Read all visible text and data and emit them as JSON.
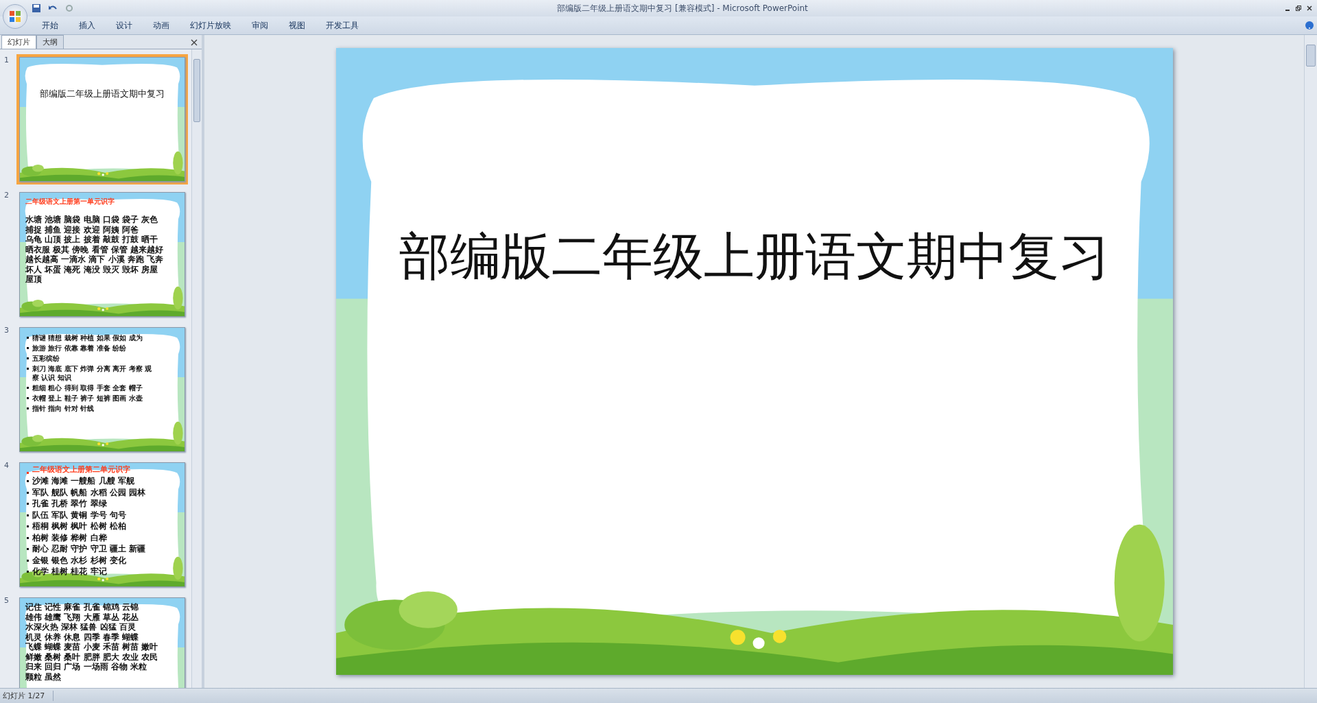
{
  "window": {
    "title": "部编版二年级上册语文期中复习 [兼容模式] - Microsoft PowerPoint"
  },
  "ribbon_tabs": [
    "开始",
    "插入",
    "设计",
    "动画",
    "幻灯片放映",
    "审阅",
    "视图",
    "开发工具"
  ],
  "panel_tabs": [
    {
      "label": "幻灯片",
      "selected": true
    },
    {
      "label": "大纲",
      "selected": false
    }
  ],
  "slides": [
    {
      "number": "1",
      "selected": true,
      "kind": "title",
      "title": "部编版二年级上册语文期中复习"
    },
    {
      "number": "2",
      "selected": false,
      "kind": "lines",
      "heading": "二年级语文上册第一单元识字",
      "lines": [
        "水塘 池塘 脑袋 电脑 口袋 袋子 灰色",
        "捕捉 捕鱼 迎接 欢迎 阿姨 阿爸",
        "乌龟 山顶 披上 披着 敲鼓 打鼓 晒干",
        "晒衣服 极其 傍晚 看管 保管 越来越好",
        "越长越高 一滴水 滴下 小溪 奔跑 飞奔",
        "坏人 坏蛋 淹死 淹没 毁灭 毁坏 房屋",
        "屋顶"
      ]
    },
    {
      "number": "3",
      "selected": false,
      "kind": "bullets",
      "lines": [
        "猜谜 猜想 栽树 种植 如果 假如 成为",
        "旅游 旅行 依靠 靠着 准备 纷纷",
        "五彩缤纷",
        "刺刀 海底 底下 炸弹 分离 离开 考察 观察 认识 知识",
        "粗细 粗心 得到 取得 手套 全套 帽子",
        "衣帽 登上 鞋子 裤子 短裤 图画 水壶",
        "指针 指向 针对 针线"
      ]
    },
    {
      "number": "4",
      "selected": false,
      "kind": "bullets",
      "heading": "二年级语文上册第二单元识字",
      "lines": [
        "沙滩 海滩 一艘船 几艘 军舰",
        "军队 舰队 帆船 水稻 公园 园林",
        "孔雀 孔桥 翠竹 翠绿",
        "队伍 军队 黄铜 学号 句号",
        "梧桐 枫树 枫叶 松树 松柏",
        "柏树 装修 桦树 白桦",
        "耐心 忍耐 守护 守卫 疆土 新疆",
        "金银 银色 水杉 杉树 变化",
        "化学 桂树 桂花 牢记"
      ]
    },
    {
      "number": "5",
      "selected": false,
      "kind": "lines",
      "lines": [
        "记住 记性 麻雀 孔雀 锦鸡 云锦",
        "雄伟 雄鹰 飞翔 大雁 草丛 花丛",
        "水深火热 深林 猛兽 凶猛 百灵",
        "机灵 休养 休息 四季 春季 蝴蝶",
        "飞蝶 蝴蝶 麦苗 小麦 禾苗 树苗 嫩叶",
        "鲜嫩 桑树 桑叶 肥胖 肥大 农业 农民",
        "归来 回归 广场 一场雨 谷物 米粒",
        "颗粒 虽然"
      ]
    }
  ],
  "slide_view": {
    "title": "部编版二年级上册语文期中复习"
  },
  "status_bar": {
    "slide_indicator": "幻灯片 1/27"
  }
}
